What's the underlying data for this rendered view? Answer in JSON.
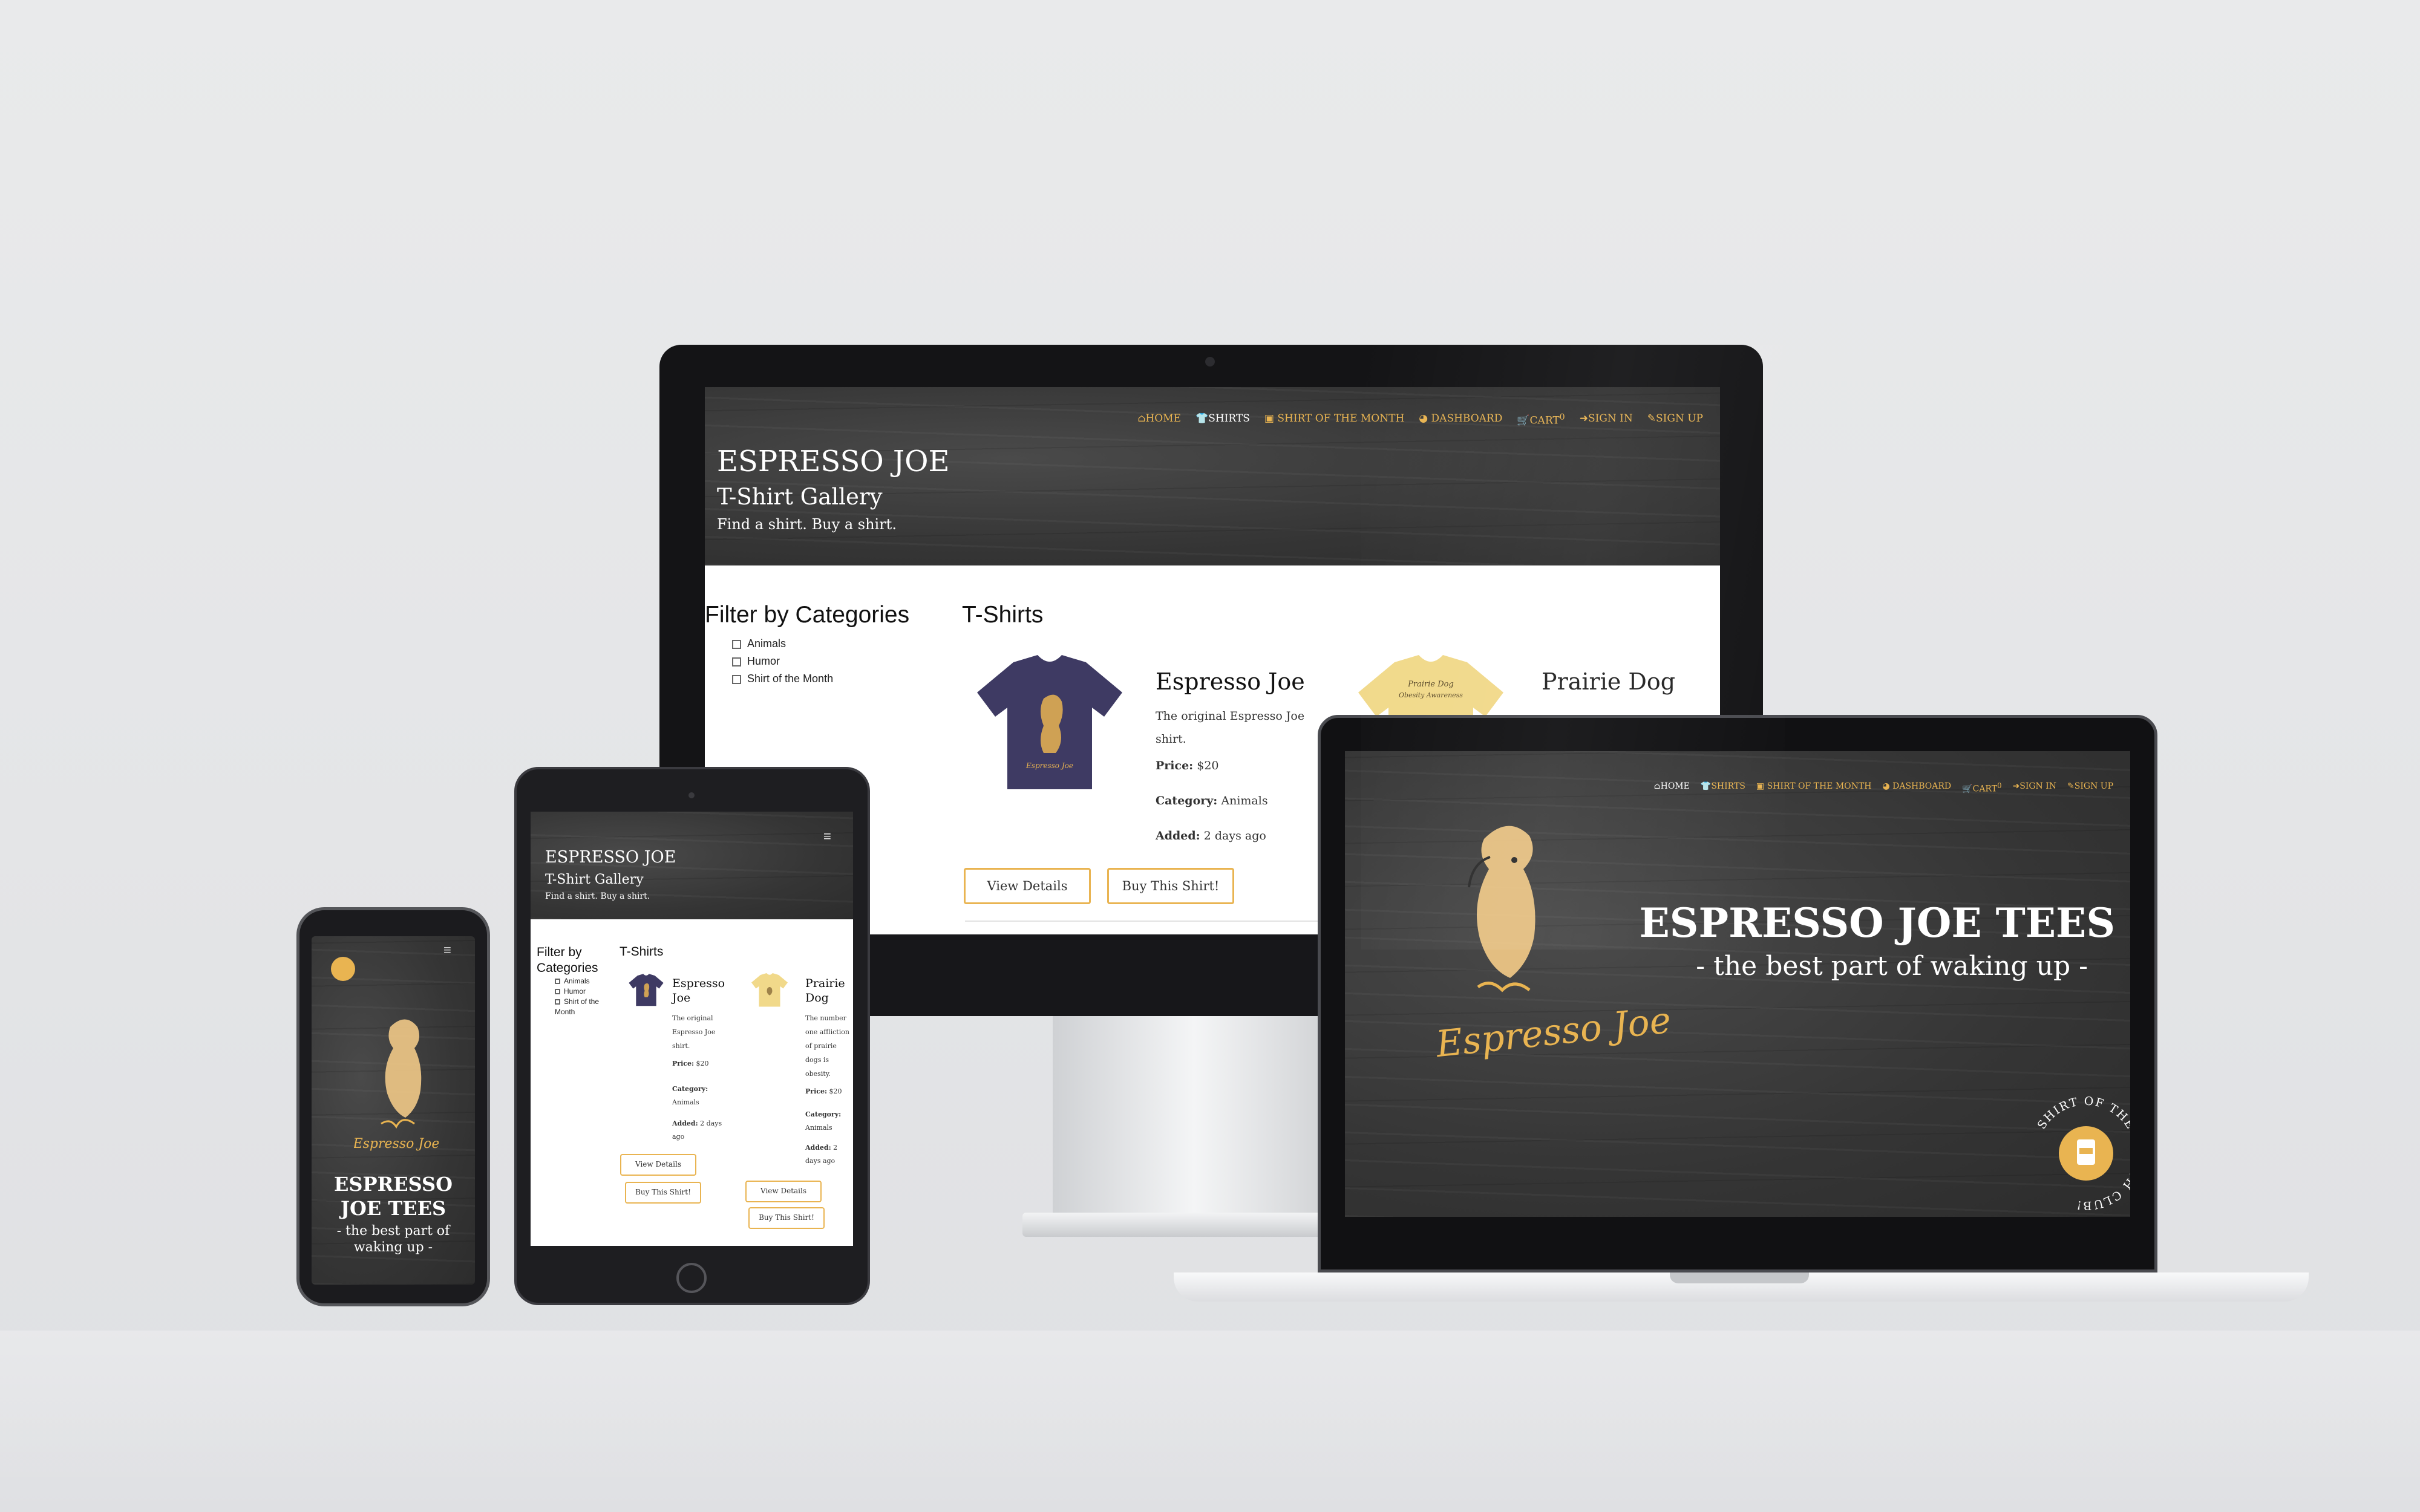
{
  "site": {
    "brand": "ESPRESSO JOE",
    "page_subtitle": "T-Shirt Gallery",
    "tagline": "Find a shirt. Buy a shirt."
  },
  "nav": {
    "items": [
      {
        "label": "HOME",
        "icon": "home-icon"
      },
      {
        "label": "SHIRTS",
        "icon": "shirt-icon"
      },
      {
        "label": "SHIRT OF THE MONTH",
        "icon": "calendar-icon"
      },
      {
        "label": "DASHBOARD",
        "icon": "dashboard-icon"
      },
      {
        "label": "CART",
        "icon": "cart-icon",
        "count": "0"
      },
      {
        "label": "SIGN IN",
        "icon": "sign-in-icon"
      },
      {
        "label": "SIGN UP",
        "icon": "sign-up-icon"
      }
    ],
    "active_color": "#ffffff",
    "link_color": "#e9b451"
  },
  "filter": {
    "heading": "Filter by Categories",
    "options": [
      "Animals",
      "Humor",
      "Shirt of the Month"
    ]
  },
  "gallery": {
    "heading": "T-Shirts",
    "products": [
      {
        "name": "Espresso Joe",
        "description": "The original Espresso Joe shirt.",
        "price_label": "Price:",
        "price": "$20",
        "category_label": "Category:",
        "category": "Animals",
        "added_label": "Added:",
        "added": "2 days ago",
        "shirt_color": "#3e3a63"
      },
      {
        "name": "Prairie Dog",
        "description": "The number one affliction of prairie dogs is obesity.",
        "price_label": "Price:",
        "price": "$20",
        "category_label": "Category:",
        "category": "Animals",
        "added_label": "Added:",
        "added": "2 days ago",
        "shirt_color": "#f1d98a",
        "shirt_print": "Prairie Dog Obesity Awareness"
      }
    ],
    "view_label": "View Details",
    "buy_label": "Buy This Shirt!"
  },
  "landing": {
    "logo_script": "Espresso Joe",
    "title": "ESPRESSO JOE TEES",
    "subtitle": "- the best part of waking up -",
    "badge_text": "SHIRT OF THE MONTH CLUB!"
  },
  "colors": {
    "accent": "#e9b451",
    "hero_bg": "#3b3b3b"
  }
}
